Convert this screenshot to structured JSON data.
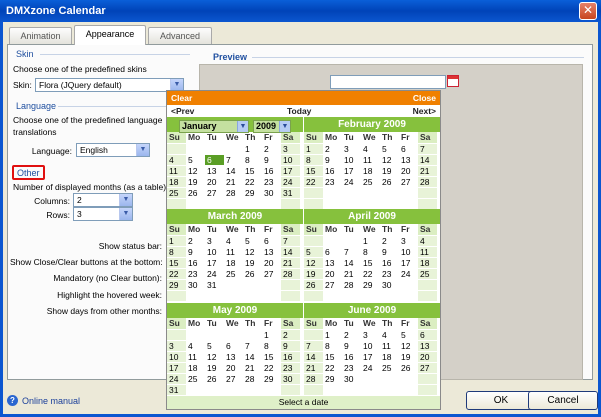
{
  "window": {
    "title": "DMXzone Calendar",
    "close_glyph": "✕"
  },
  "tabs": [
    {
      "label": "Animation"
    },
    {
      "label": "Appearance"
    },
    {
      "label": "Advanced"
    }
  ],
  "skin": {
    "section": "Skin",
    "description": "Choose one of the predefined skins",
    "label": "Skin:",
    "value": "Flora (JQuery default)"
  },
  "language": {
    "section": "Language",
    "description_line1": "Choose one of the predefined language",
    "description_line2": "translations",
    "label": "Language:",
    "value": "English"
  },
  "other": {
    "section": "Other",
    "months_label": "Number of displayed months (as a table)",
    "columns_label": "Columns:",
    "columns_value": "2",
    "rows_label": "Rows:",
    "rows_value": "3",
    "status_bar_label": "Show status bar:",
    "closeclear_label": "Show Close/Clear buttons at the bottom:",
    "mandatory_label": "Mandatory (no Clear button):",
    "highlight_label": "Highlight the hovered week:",
    "otherdays_label": "Show days from other months:"
  },
  "preview": {
    "title": "Preview"
  },
  "calendar": {
    "clear": "Clear",
    "close": "Close",
    "prev": "<Prev",
    "today": "Today",
    "next": "Next>",
    "select_month": "January",
    "select_year": "2009",
    "status": "Select a date",
    "weekdays": [
      "Su",
      "Mo",
      "Tu",
      "We",
      "Th",
      "Fr",
      "Sa"
    ],
    "months": [
      {
        "name": "January",
        "start": 4,
        "days": 31,
        "today": 6
      },
      {
        "name": "February 2009",
        "start": 0,
        "days": 28
      },
      {
        "name": "March 2009",
        "start": 0,
        "days": 31
      },
      {
        "name": "April 2009",
        "start": 3,
        "days": 30
      },
      {
        "name": "May 2009",
        "start": 5,
        "days": 31
      },
      {
        "name": "June 2009",
        "start": 1,
        "days": 30
      }
    ]
  },
  "footer": {
    "online_manual": "Online manual",
    "help_glyph": "?",
    "ok": "OK",
    "cancel": "Cancel"
  }
}
